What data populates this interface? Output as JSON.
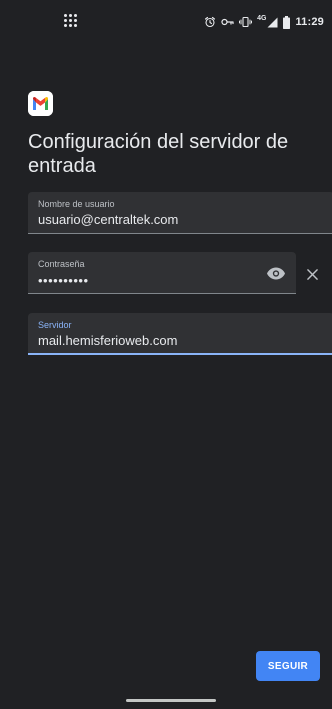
{
  "status_bar": {
    "time": "11:29",
    "network_label": "4G",
    "icons": [
      "app-grid-icon",
      "alarm-icon",
      "vpn-key-icon",
      "vibrate-icon",
      "signal-icon",
      "battery-icon"
    ]
  },
  "app": {
    "logo_icon": "gmail-logo-icon",
    "brand_colors": {
      "red": "#ea4335",
      "blue": "#4285f4",
      "green": "#34a853",
      "yellow": "#fbbc04"
    }
  },
  "page": {
    "title": "Configuración del servidor de entrada"
  },
  "form": {
    "username": {
      "label": "Nombre de usuario",
      "value": "usuario@centraltek.com"
    },
    "password": {
      "label": "Contraseña",
      "masked_value": "••••••••••",
      "reveal_icon": "eye-icon",
      "clear_icon": "close-icon"
    },
    "server": {
      "label": "Servidor",
      "value": "mail.hemisferioweb.com"
    }
  },
  "actions": {
    "next_label": "SEGUIR"
  },
  "colors": {
    "background": "#202124",
    "field_background": "#303134",
    "accent": "#8ab4f8",
    "button": "#4285f4"
  }
}
